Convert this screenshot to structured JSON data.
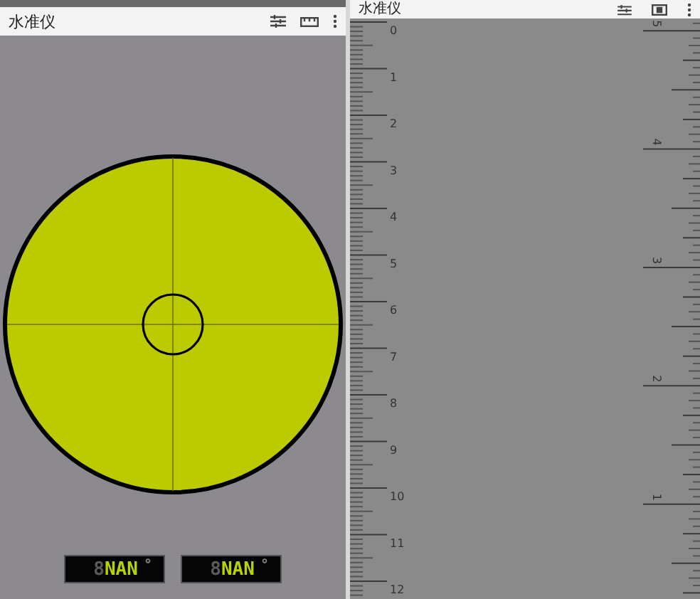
{
  "left_screen": {
    "app_bar": {
      "title": "水准仪"
    },
    "bubble_level": {
      "kind": "circle"
    },
    "readouts": [
      {
        "ghost": "8",
        "value": "NAN",
        "unit": "°"
      },
      {
        "ghost": "8",
        "value": "NAN",
        "unit": "°"
      }
    ]
  },
  "right_screen": {
    "app_bar": {
      "title": "水准仪"
    },
    "ruler": {
      "cm_labels": [
        "0",
        "1",
        "2",
        "3",
        "4",
        "5",
        "6",
        "7",
        "8",
        "9",
        "10",
        "11",
        "12"
      ],
      "inch_labels": [
        "1",
        "2",
        "3",
        "4",
        "5"
      ]
    }
  }
}
